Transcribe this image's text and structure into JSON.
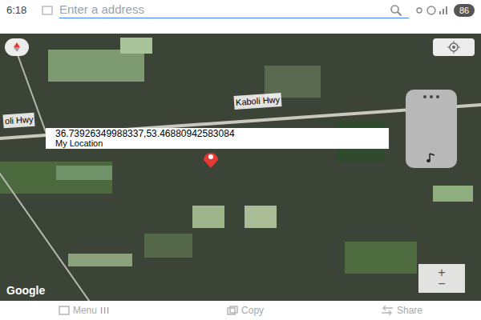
{
  "status_bar": {
    "time": "6:18",
    "battery": "86"
  },
  "search": {
    "placeholder": "Enter a address"
  },
  "map": {
    "road_labels": [
      {
        "text": "Kaboli Hwy"
      },
      {
        "text": "oli Hwy"
      }
    ],
    "pin": {
      "coordinates": "36.73926349988337,53.46880942583084",
      "label": "My Location"
    },
    "attribution": "Google"
  },
  "zoom": {
    "plus": "+",
    "minus": "−"
  },
  "bottom_bar": [
    {
      "label": "Menu",
      "icon": "III"
    },
    {
      "label": "Copy"
    },
    {
      "label": "Share"
    }
  ]
}
